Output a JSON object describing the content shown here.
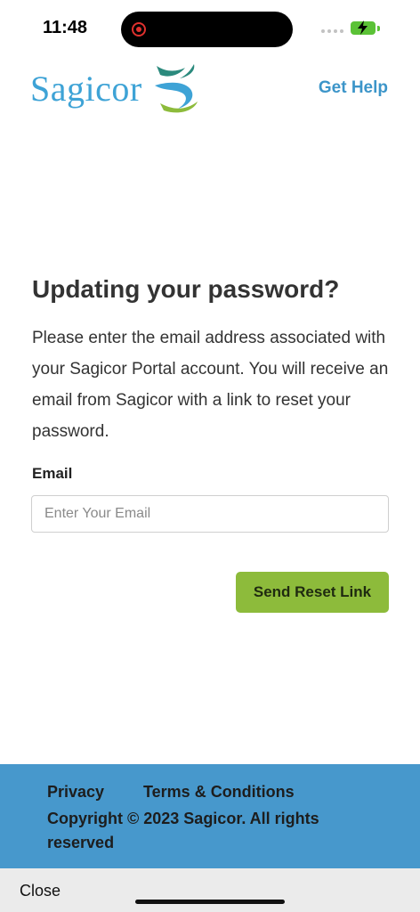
{
  "status_bar": {
    "time": "11:48"
  },
  "header": {
    "logo_text": "Sagicor",
    "get_help": "Get Help"
  },
  "main": {
    "title": "Updating your password?",
    "description": "Please enter the email address associated with your Sagicor Portal account. You will receive an email from Sagicor with a link to reset your password.",
    "email_label": "Email",
    "email_placeholder": "Enter Your Email",
    "email_value": "",
    "send_button": "Send Reset Link"
  },
  "footer": {
    "privacy": "Privacy",
    "terms": "Terms & Conditions",
    "copyright": "Copyright © 2023 Sagicor. All rights reserved"
  },
  "bottom_bar": {
    "close": "Close"
  },
  "colors": {
    "brand_blue": "#3ea3d6",
    "brand_green": "#8dbb3b",
    "footer_bg": "#4798cc",
    "link_blue": "#3c95c9"
  },
  "icons": [
    "record-icon",
    "signal-icon",
    "battery-charging-icon",
    "sagicor-logo-mark"
  ]
}
